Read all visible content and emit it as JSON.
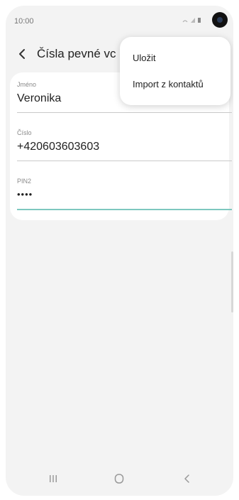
{
  "status_bar": {
    "time": "10:00",
    "icons": "≈ ⊿ ▮"
  },
  "app_bar": {
    "back_icon": "chevron-left-icon",
    "title": "Čísla pevné vc"
  },
  "form": {
    "name_label": "Jméno",
    "name_value": "Veronika",
    "number_label": "Číslo",
    "number_value": "+420603603603",
    "pin_label": "PIN2",
    "pin_value": "••••"
  },
  "menu": {
    "items": [
      {
        "label": "Uložit"
      },
      {
        "label": "Import z kontaktů"
      }
    ]
  },
  "nav": {
    "recents_icon": "recents-icon",
    "home_icon": "home-icon",
    "back_icon": "back-icon"
  },
  "colors": {
    "screen_bg": "#f3f3f3",
    "card_bg": "#ffffff",
    "active_underline": "#7ec8bf"
  }
}
